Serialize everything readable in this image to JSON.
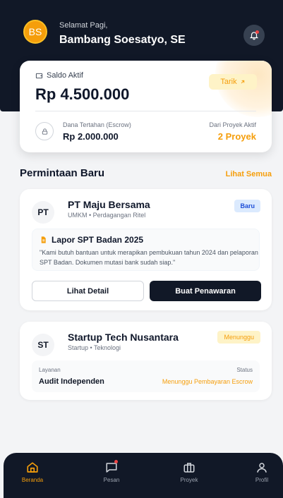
{
  "header": {
    "avatar_initials": "BS",
    "greeting": "Selamat Pagi,",
    "user_name": "Bambang Soesatyo, SE"
  },
  "wallet": {
    "saldo_label": "Saldo Aktif",
    "saldo_value": "Rp 4.500.000",
    "tarik_label": "Tarik",
    "escrow_label": "Dana Tertahan (Escrow)",
    "escrow_value": "Rp 2.000.000",
    "projects_label": "Dari Proyek Aktif",
    "projects_value": "2 Proyek"
  },
  "requests": {
    "title": "Permintaan Baru",
    "see_all": "Lihat Semua",
    "items": [
      {
        "initials": "PT",
        "company": "PT Maju Bersama",
        "subtitle": "UMKM • Perdagangan Ritel",
        "badge": "Baru",
        "request_title": "Lapor SPT Badan 2025",
        "request_desc": "\"Kami butuh bantuan untuk merapikan pembukuan tahun 2024 dan pelaporan SPT Badan. Dokumen mutasi bank sudah siap.\"",
        "detail_button": "Lihat Detail",
        "offer_button": "Buat Penawaran"
      },
      {
        "initials": "ST",
        "company": "Startup Tech Nusantara",
        "subtitle": "Startup • Teknologi",
        "badge": "Menunggu",
        "service_label": "Layanan",
        "service_value": "Audit Independen",
        "status_label": "Status",
        "status_value": "Menunggu Pembayaran Escrow"
      }
    ]
  },
  "nav": {
    "items": [
      {
        "label": "Beranda",
        "icon": "home-icon",
        "active": true
      },
      {
        "label": "Pesan",
        "icon": "message-icon",
        "active": false
      },
      {
        "label": "Proyek",
        "icon": "briefcase-icon",
        "active": false
      },
      {
        "label": "Profil",
        "icon": "user-icon",
        "active": false
      }
    ]
  },
  "colors": {
    "dark": "#111827",
    "accent": "#f59e0b",
    "badge_blue": "#1d4ed8"
  }
}
